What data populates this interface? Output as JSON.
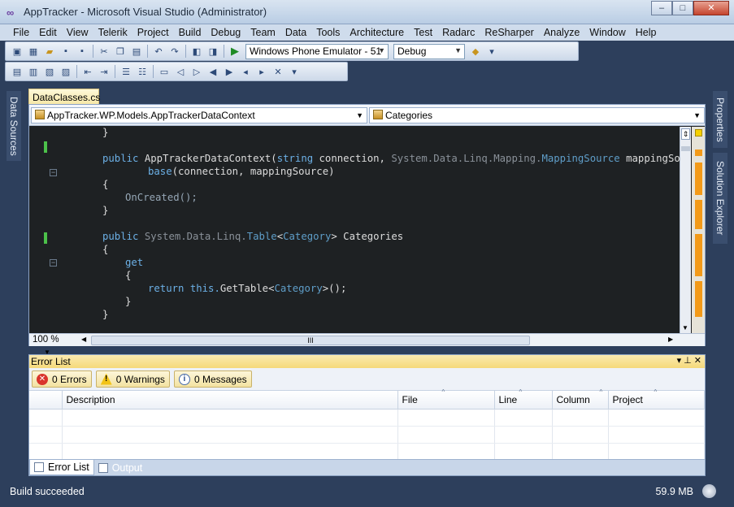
{
  "window": {
    "title": "AppTracker - Microsoft Visual Studio (Administrator)",
    "buttons": [
      "–",
      "□",
      "✕"
    ]
  },
  "menu": [
    "File",
    "Edit",
    "View",
    "Telerik",
    "Project",
    "Build",
    "Debug",
    "Team",
    "Data",
    "Tools",
    "Architecture",
    "Test",
    "Radarc",
    "ReSharper",
    "Analyze",
    "Window",
    "Help"
  ],
  "toolbar": {
    "target": "Windows Phone Emulator - 51",
    "config": "Debug"
  },
  "side_tabs": {
    "left": "Data Sources",
    "right_top": "Properties",
    "right_bottom": "Solution Explorer"
  },
  "editor": {
    "tab": "DataClasses.cs",
    "nav_left": "AppTracker.WP.Models.AppTrackerDataContext",
    "nav_right": "Categories",
    "zoom": "100 %",
    "scroll_thumb": "III"
  },
  "code": {
    "l1": "}",
    "l2_kw": "public",
    "l2_name": "AppTrackerDataContext(",
    "l2_type": "string",
    "l2_a": " connection, ",
    "l2_ns": "System.Data.Linq.Mapping.",
    "l2_ty2": "MappingSource",
    "l2_b": " mappingSource)",
    "l3_kw": "base",
    "l3_rest": "(connection, mappingSource)",
    "l4": "{",
    "l5": "OnCreated();",
    "l6": "}",
    "l7_kw": "public",
    "l7_ns": "System.Data.Linq.",
    "l7_ty": "Table",
    "l7_lt": "<",
    "l7_ty2": "Category",
    "l7_gt": ">",
    "l7_name": " Categories",
    "l8": "{",
    "l9_kw": "get",
    "l10": "{",
    "l11_kw": "return",
    "l11_this": "this.",
    "l11_fn": "GetTable",
    "l11_lt": "<",
    "l11_ty": "Category",
    "l11_end": ">();",
    "l12": "}",
    "l13": "}"
  },
  "error_list": {
    "title": "Error List",
    "controls": "▾ ⊥ ✕",
    "filters": {
      "errors": "0 Errors",
      "warnings": "0 Warnings",
      "messages": "0 Messages"
    },
    "columns": [
      "Description",
      "File",
      "Line",
      "Column",
      "Project"
    ]
  },
  "bottom_tabs": [
    "Error List",
    "Output"
  ],
  "status": {
    "message": "Build succeeded",
    "memory": "59.9 MB"
  }
}
